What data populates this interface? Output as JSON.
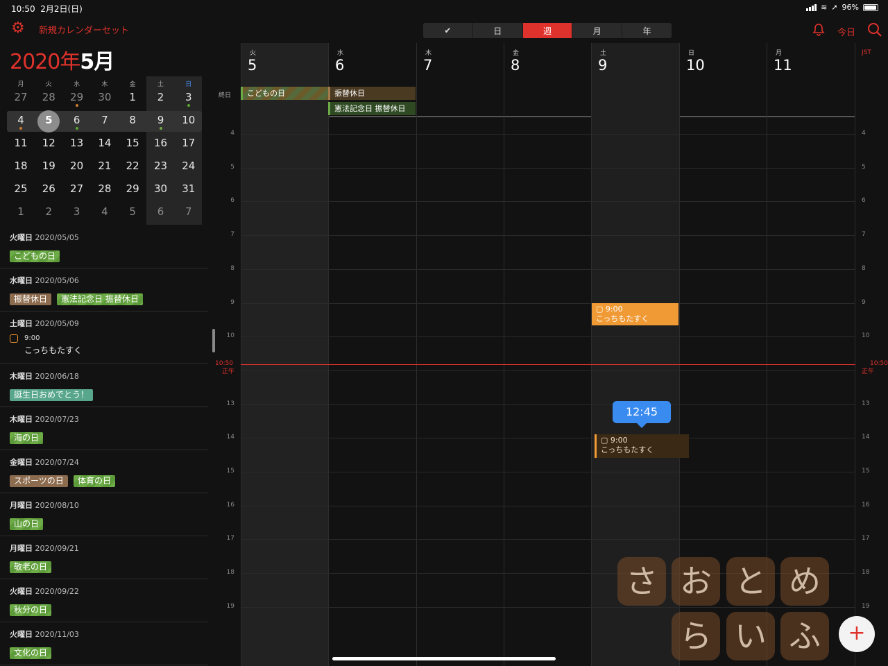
{
  "status": {
    "time": "10:50",
    "date": "2月2日(日)",
    "battery": "96%"
  },
  "toolbar": {
    "gear_icon": "gear-icon",
    "calendar_set": "新規カレンダーセット",
    "segments": [
      "✔",
      "日",
      "週",
      "月",
      "年"
    ],
    "active_segment": "週",
    "bell_icon": "bell-icon",
    "today": "今日",
    "search_icon": "search-icon"
  },
  "month_title": {
    "year": "2020年",
    "month": "5月"
  },
  "mini_calendar": {
    "dow": [
      "月",
      "火",
      "水",
      "木",
      "金",
      "土",
      "日"
    ],
    "weeks": [
      [
        "27",
        "28",
        "29",
        "30",
        "1",
        "2",
        "3"
      ],
      [
        "4",
        "5",
        "6",
        "7",
        "8",
        "9",
        "10"
      ],
      [
        "11",
        "12",
        "13",
        "14",
        "15",
        "16",
        "17"
      ],
      [
        "18",
        "19",
        "20",
        "21",
        "22",
        "23",
        "24"
      ],
      [
        "25",
        "26",
        "27",
        "28",
        "29",
        "30",
        "31"
      ],
      [
        "1",
        "2",
        "3",
        "4",
        "5",
        "6",
        "7"
      ]
    ],
    "selected": "5"
  },
  "agenda": [
    {
      "day": "火曜日",
      "date": "2020/05/05",
      "items": [
        {
          "label": "こどもの日",
          "color": "green"
        }
      ]
    },
    {
      "day": "水曜日",
      "date": "2020/05/06",
      "items": [
        {
          "label": "振替休日",
          "color": "brown"
        },
        {
          "label": "憲法記念日 振替休日",
          "color": "green"
        }
      ]
    },
    {
      "day": "土曜日",
      "date": "2020/05/09",
      "todo": {
        "time": "9:00",
        "title": "こっちもたすく"
      }
    },
    {
      "day": "木曜日",
      "date": "2020/06/18",
      "items": [
        {
          "label": "誕生日おめでとう！",
          "color": "teal"
        }
      ]
    },
    {
      "day": "木曜日",
      "date": "2020/07/23",
      "items": [
        {
          "label": "海の日",
          "color": "green"
        }
      ]
    },
    {
      "day": "金曜日",
      "date": "2020/07/24",
      "items": [
        {
          "label": "スポーツの日",
          "color": "brown"
        },
        {
          "label": "体育の日",
          "color": "green"
        }
      ]
    },
    {
      "day": "月曜日",
      "date": "2020/08/10",
      "items": [
        {
          "label": "山の日",
          "color": "green"
        }
      ]
    },
    {
      "day": "月曜日",
      "date": "2020/09/21",
      "items": [
        {
          "label": "敬老の日",
          "color": "green"
        }
      ]
    },
    {
      "day": "火曜日",
      "date": "2020/09/22",
      "items": [
        {
          "label": "秋分の日",
          "color": "green"
        }
      ]
    },
    {
      "day": "火曜日",
      "date": "2020/11/03",
      "items": [
        {
          "label": "文化の日",
          "color": "green"
        }
      ]
    }
  ],
  "week": {
    "columns": [
      {
        "dow": "火",
        "day": "5"
      },
      {
        "dow": "水",
        "day": "6"
      },
      {
        "dow": "木",
        "day": "7"
      },
      {
        "dow": "金",
        "day": "8"
      },
      {
        "dow": "土",
        "day": "9"
      },
      {
        "dow": "日",
        "day": "10"
      },
      {
        "dow": "月",
        "day": "11"
      }
    ],
    "timezone": "JST",
    "allday_label": "終日",
    "allday_events": [
      "こどもの日",
      "振替休日",
      "憲法記念日 振替休日"
    ],
    "hours": [
      "4",
      "5",
      "6",
      "7",
      "8",
      "9",
      "10",
      "正午",
      "13",
      "14",
      "15",
      "16",
      "17",
      "18",
      "19"
    ],
    "now_label": "10:50",
    "event": {
      "time": "9:00",
      "title": "こっちもたすく"
    },
    "drag_time": "12:45",
    "drag_event": {
      "time": "9:00",
      "title": "こっちもたすく"
    }
  },
  "watermark": [
    "さ",
    "お",
    "と",
    "め",
    "ら",
    "い",
    "ふ"
  ],
  "fab_label": "+"
}
